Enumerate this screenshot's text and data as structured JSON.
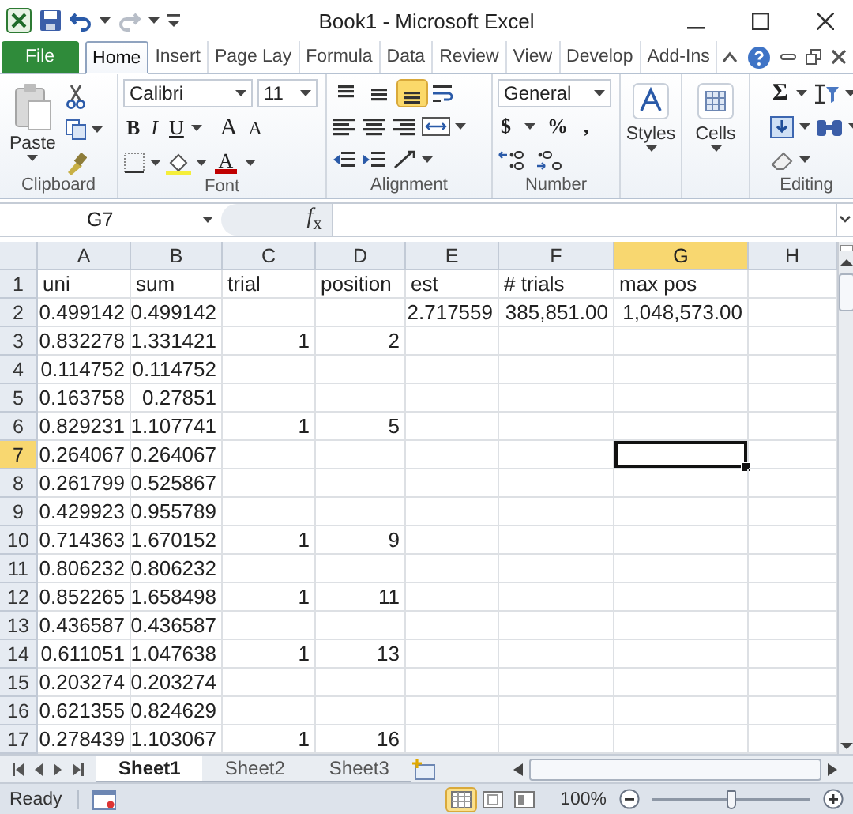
{
  "window": {
    "title": "Book1 - Microsoft Excel"
  },
  "ribbon_tabs": [
    {
      "label": "File",
      "kind": "file",
      "selected": false
    },
    {
      "label": "Home",
      "kind": "tab",
      "selected": true
    },
    {
      "label": "Insert",
      "kind": "tab",
      "selected": false
    },
    {
      "label": "Page Lay",
      "kind": "tab",
      "selected": false
    },
    {
      "label": "Formula",
      "kind": "tab",
      "selected": false
    },
    {
      "label": "Data",
      "kind": "tab",
      "selected": false
    },
    {
      "label": "Review",
      "kind": "tab",
      "selected": false
    },
    {
      "label": "View",
      "kind": "tab",
      "selected": false
    },
    {
      "label": "Develop",
      "kind": "tab",
      "selected": false
    },
    {
      "label": "Add-Ins",
      "kind": "tab",
      "selected": false
    }
  ],
  "ribbon": {
    "clipboard": {
      "label": "Clipboard",
      "paste": "Paste"
    },
    "font": {
      "label": "Font",
      "family": "Calibri",
      "size": "11",
      "style_buttons": [
        "B",
        "I",
        "U"
      ],
      "grow": "A",
      "shrink": "A",
      "color_letter": "A"
    },
    "alignment": {
      "label": "Alignment",
      "vertical": [
        {
          "selected": false
        },
        {
          "selected": false
        },
        {
          "selected": true
        }
      ]
    },
    "number": {
      "label": "Number",
      "format": "General",
      "buttons": [
        "$",
        "%",
        ","
      ]
    },
    "styles": {
      "label": "Styles"
    },
    "cells": {
      "label": "Cells"
    },
    "editing": {
      "label": "Editing",
      "sum": "Σ"
    }
  },
  "formula_bar": {
    "name_box": "G7",
    "function_label": "*f*$_{x}$"
  },
  "columns": [
    {
      "label": "A",
      "selected": false
    },
    {
      "label": "B",
      "selected": false
    },
    {
      "label": "C",
      "selected": false
    },
    {
      "label": "D",
      "selected": false
    },
    {
      "label": "E",
      "selected": false
    },
    {
      "label": "F",
      "selected": false
    },
    {
      "label": "G",
      "selected": true
    },
    {
      "label": "H",
      "selected": false
    }
  ],
  "rows": [
    {
      "label": "1",
      "selected": false,
      "kind": "text",
      "cells": [
        "uni",
        "sum",
        "trial",
        "position",
        "est",
        "# trials",
        "max pos"
      ]
    },
    {
      "label": "2",
      "selected": false,
      "kind": "number",
      "cells": [
        "0.499142",
        "0.499142",
        null,
        null,
        "2.717559",
        "385,851.00",
        "1,048,573.00"
      ]
    },
    {
      "label": "3",
      "selected": false,
      "kind": "number",
      "cells": [
        "0.832278",
        "1.331421",
        "1",
        "2"
      ]
    },
    {
      "label": "4",
      "selected": false,
      "kind": "number",
      "cells": [
        "0.114752",
        "0.114752"
      ]
    },
    {
      "label": "5",
      "selected": false,
      "kind": "number",
      "cells": [
        "0.163758",
        "0.27851"
      ]
    },
    {
      "label": "6",
      "selected": false,
      "kind": "number",
      "cells": [
        "0.829231",
        "1.107741",
        "1",
        "5"
      ]
    },
    {
      "label": "7",
      "selected": true,
      "kind": "number",
      "cells": [
        "0.264067",
        "0.264067"
      ]
    },
    {
      "label": "8",
      "selected": false,
      "kind": "number",
      "cells": [
        "0.261799",
        "0.525867"
      ]
    },
    {
      "label": "9",
      "selected": false,
      "kind": "number",
      "cells": [
        "0.429923",
        "0.955789"
      ]
    },
    {
      "label": "10",
      "selected": false,
      "kind": "number",
      "cells": [
        "0.714363",
        "1.670152",
        "1",
        "9"
      ]
    },
    {
      "label": "11",
      "selected": false,
      "kind": "number",
      "cells": [
        "0.806232",
        "0.806232"
      ]
    },
    {
      "label": "12",
      "selected": false,
      "kind": "number",
      "cells": [
        "0.852265",
        "1.658498",
        "1",
        "11"
      ]
    },
    {
      "label": "13",
      "selected": false,
      "kind": "number",
      "cells": [
        "0.436587",
        "0.436587"
      ]
    },
    {
      "label": "14",
      "selected": false,
      "kind": "number",
      "cells": [
        "0.611051",
        "1.047638",
        "1",
        "13"
      ]
    },
    {
      "label": "15",
      "selected": false,
      "kind": "number",
      "cells": [
        "0.203274",
        "0.203274"
      ]
    },
    {
      "label": "16",
      "selected": false,
      "kind": "number",
      "cells": [
        "0.621355",
        "0.824629"
      ]
    },
    {
      "label": "17",
      "selected": false,
      "kind": "number",
      "cells": [
        "0.278439",
        "1.103067",
        "1",
        "16"
      ]
    }
  ],
  "sheet_tabs": [
    {
      "label": "Sheet1",
      "selected": true
    },
    {
      "label": "Sheet2",
      "selected": false
    },
    {
      "label": "Sheet3",
      "selected": false
    }
  ],
  "status_bar": {
    "text": "Ready",
    "views": [
      {
        "kind": "normal",
        "selected": true
      },
      {
        "kind": "page_layout",
        "selected": false
      },
      {
        "kind": "page_break",
        "selected": false
      }
    ],
    "zoom": {
      "reading": "100%",
      "level": 0.5
    }
  }
}
